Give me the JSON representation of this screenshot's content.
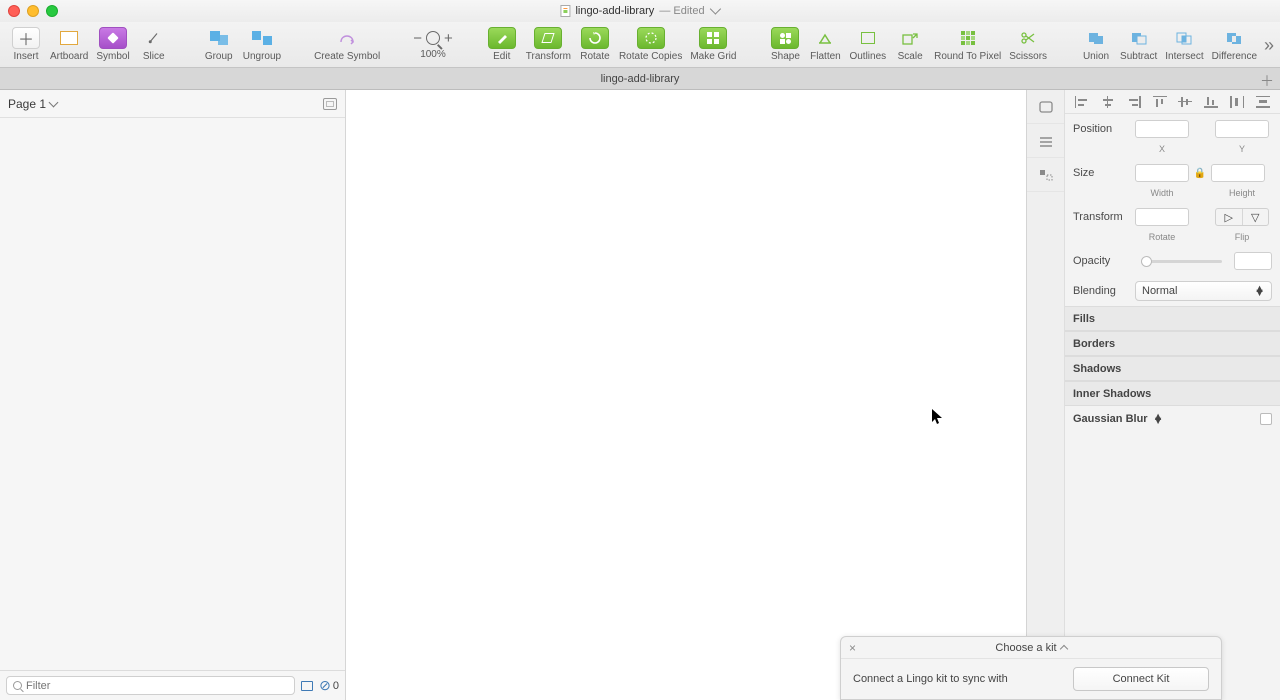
{
  "title": {
    "filename": "lingo-add-library",
    "status": "— Edited"
  },
  "toolbar": {
    "items": [
      "Insert",
      "Artboard",
      "Symbol",
      "Slice",
      "Group",
      "Ungroup",
      "Create Symbol",
      "100%",
      "Edit",
      "Transform",
      "Rotate",
      "Rotate Copies",
      "Make Grid",
      "Shape",
      "Flatten",
      "Outlines",
      "Scale",
      "Round To Pixel",
      "Scissors",
      "Union",
      "Subtract",
      "Intersect",
      "Difference"
    ],
    "zoom": "100%"
  },
  "tab": {
    "name": "lingo-add-library"
  },
  "pages": {
    "current": "Page 1"
  },
  "filter": {
    "placeholder": "Filter",
    "count": "0"
  },
  "inspector": {
    "position": "Position",
    "x": "X",
    "y": "Y",
    "size": "Size",
    "width": "Width",
    "height": "Height",
    "transform": "Transform",
    "rotate": "Rotate",
    "flip": "Flip",
    "opacity": "Opacity",
    "blending": "Blending",
    "blend_mode": "Normal",
    "fills": "Fills",
    "borders": "Borders",
    "shadows": "Shadows",
    "inner_shadows": "Inner Shadows",
    "blur": "Gaussian Blur"
  },
  "popup": {
    "title": "Choose a kit",
    "msg": "Connect a Lingo kit to sync with",
    "btn": "Connect Kit"
  }
}
